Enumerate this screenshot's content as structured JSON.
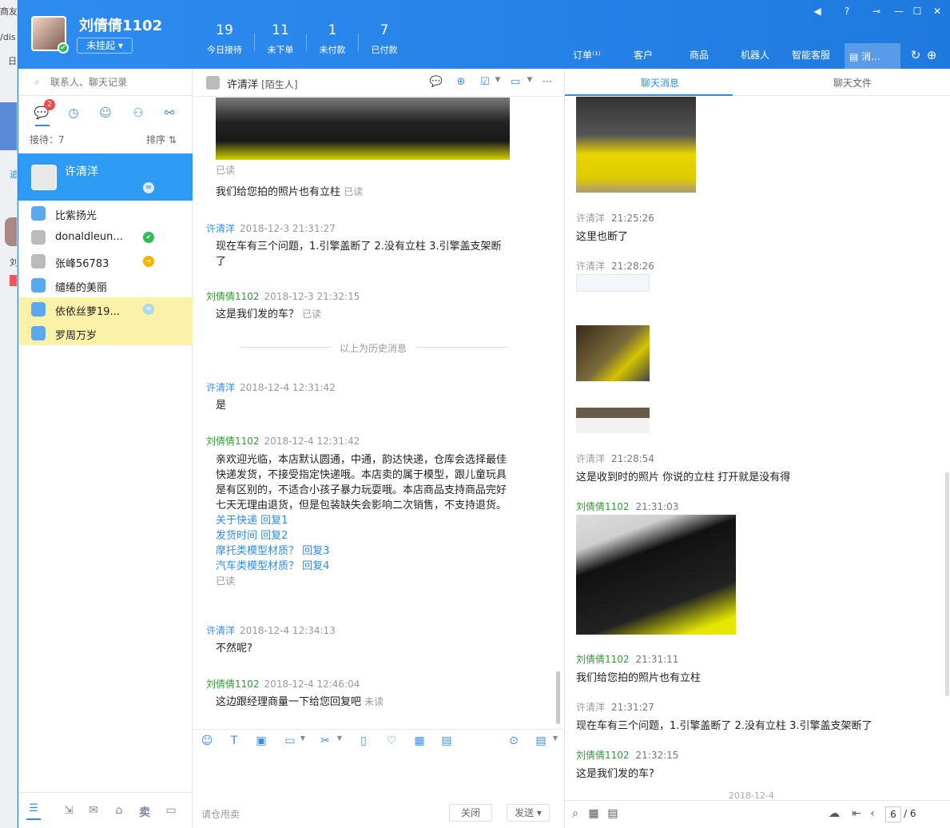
{
  "bgstrip": {
    "frags": [
      "商友",
      "/dis",
      "日",
      "追",
      "刘"
    ]
  },
  "header": {
    "user_name": "刘倩倩1102",
    "status_label": "未挂起 ▾",
    "stats": [
      {
        "num": "19",
        "label": "今日接待"
      },
      {
        "num": "11",
        "label": "未下单"
      },
      {
        "num": "1",
        "label": "未付款"
      },
      {
        "num": "7",
        "label": "已付款"
      }
    ],
    "nav": [
      "订单⁽¹⁾",
      "客户",
      "商品",
      "机器人",
      "智能客服"
    ],
    "nav_active": "消..."
  },
  "left": {
    "search_placeholder": "联系人、聊天记录",
    "badge": "2",
    "recv": "接待：7",
    "sort": "排序 ⇅",
    "active_contact": "许清洋",
    "contacts": [
      {
        "name": "比紫扬光",
        "color": "#5aa9ee"
      },
      {
        "name": "donaldleun...",
        "color": "#bbbbbb",
        "badge": "✔",
        "badge_color": "#2ebd59"
      },
      {
        "name": "张峰56783",
        "color": "#bbbbbb",
        "badge": "➔",
        "badge_color": "#f5b400"
      },
      {
        "name": "缱绻的美丽",
        "color": "#5aa9ee"
      },
      {
        "name": "依依丝萝19...",
        "color": "#5aa9ee",
        "badge": "✉",
        "badge_color": "#a9d8f5",
        "highlight": true
      },
      {
        "name": "罗周万岁",
        "color": "#5aa9ee",
        "highlight": true
      }
    ]
  },
  "chat": {
    "name": "许清洋",
    "tag": "[陌生人]",
    "messages": {
      "r1": "已读",
      "t1": "我们给您拍的照片也有立柱",
      "s2": "许清洋",
      "ts2": "2018-12-3 21:31:27",
      "t2": "现在车有三个问题，1.引擎盖断了 2.没有立柱 3.引擎盖支架断了",
      "s3": "刘倩倩1102",
      "ts3": "2018-12-3 21:32:15",
      "t3": "这是我们发的车？",
      "hist": "以上为历史消息",
      "s4": "许清洋",
      "ts4": "2018-12-4 12:31:42",
      "t4": "是",
      "s5": "刘倩倩1102",
      "ts5": "2018-12-4 12:31:42",
      "t5": "亲欢迎光临，本店默认圆通，中通，韵达快递，仓库会选择最佳快递发货，不接受指定快递哦。本店卖的属于模型，跟儿童玩具是有区别的，不适合小孩子暴力玩耍哦。本店商品支持商品完好七天无理由退货，但是包装缺失会影响二次销售，不支持退货。",
      "l1": "关于快递 回复1",
      "l2": "发货时间 回复2",
      "l3": "摩托类模型材质？ 回复3",
      "l4": "汽车类模型材质？ 回复4",
      "s6": "许清洋",
      "ts6": "2018-12-4 12:34:13",
      "t6": "不然呢?",
      "s7": "刘倩倩1102",
      "ts7": "2018-12-4 12:46:04",
      "t7": "这边跟经理商量一下给您回复吧",
      "unread": "未读"
    },
    "quick": "请仓甩卖",
    "close": "关闭",
    "send": "发送 ▾"
  },
  "right": {
    "tab1": "聊天消息",
    "tab2": "聊天文件",
    "items": {
      "a_s": "许清洋",
      "a_t": "21:25:26",
      "a_x": "这里也断了",
      "b_s": "许清洋",
      "b_t": "21:28:26",
      "c_s": "许清洋",
      "c_t": "21:28:54",
      "c_x": "这是收到时的照片 你说的立柱 打开就是没有得",
      "d_s": "刘倩倩1102",
      "d_t": "21:31:03",
      "e_s": "刘倩倩1102",
      "e_t": "21:31:11",
      "e_x": "我们给您拍的照片也有立柱",
      "f_s": "许清洋",
      "f_t": "21:31:27",
      "f_x": "现在车有三个问题，1.引擎盖断了 2.没有立柱 3.引擎盖支架断了",
      "g_s": "刘倩倩1102",
      "g_t": "21:32:15",
      "g_x": "这是我们发的车?",
      "date": "2018-12-4"
    },
    "page": "6",
    "total": "/ 6"
  }
}
